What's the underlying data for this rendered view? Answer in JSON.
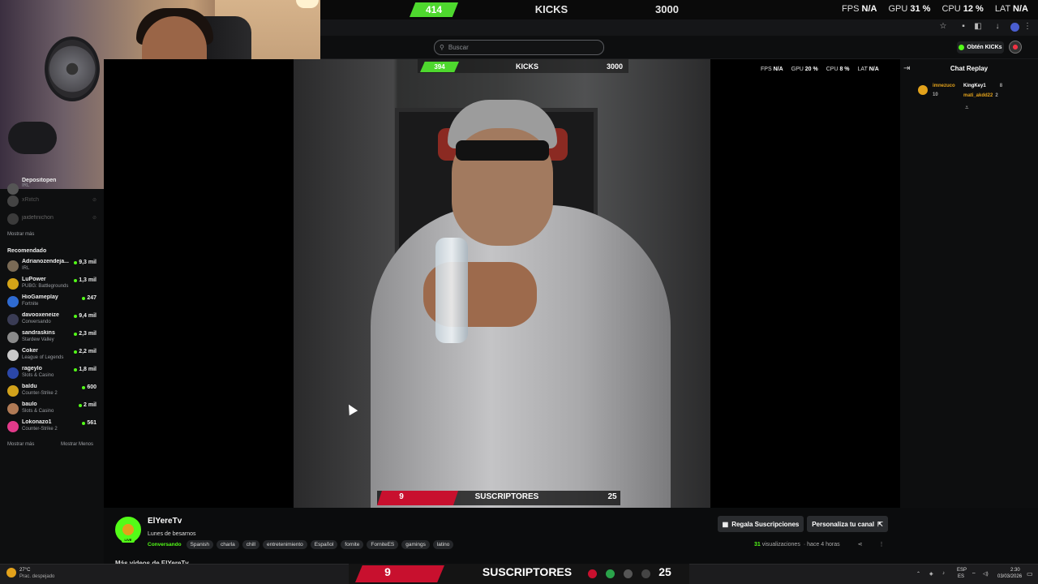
{
  "overlay_top": {
    "counter": "414",
    "kicks_label": "KICKS",
    "kicks_goal": "3000",
    "stats": [
      {
        "label": "FPS",
        "value": "N/A"
      },
      {
        "label": "GPU",
        "value": "31 %"
      },
      {
        "label": "CPU",
        "value": "12 %"
      },
      {
        "label": "LAT",
        "value": "N/A"
      }
    ]
  },
  "header": {
    "search_placeholder": "Buscar",
    "get_kicks_label": "Obtén KICKs"
  },
  "overlay_inner": {
    "counter": "394",
    "kicks_label": "KICKS",
    "kicks_goal": "3000",
    "stats": [
      {
        "label": "FPS",
        "value": "N/A"
      },
      {
        "label": "GPU",
        "value": "20 %"
      },
      {
        "label": "CPU",
        "value": "8 %"
      },
      {
        "label": "LAT",
        "value": "N/A"
      }
    ]
  },
  "sidebar": {
    "following_partial": [
      {
        "name": "Depositopen",
        "cat": "IRL"
      },
      {
        "name": "xRiitch",
        "cat": ""
      },
      {
        "name": "jaidefinichon",
        "cat": ""
      }
    ],
    "show_more": "Mostrar más",
    "recommended_title": "Recomendado",
    "recommended": [
      {
        "name": "Adrianozendeja...",
        "cat": "IRL",
        "viewers": "9,3 mil",
        "color": "#7a6a55"
      },
      {
        "name": "LuPower",
        "cat": "PUBG: Battlegrounds",
        "viewers": "1,3 mil",
        "color": "#d4a418"
      },
      {
        "name": "HioGameplay",
        "cat": "Fortnite",
        "viewers": "247",
        "color": "#2f6bd1"
      },
      {
        "name": "davooxeneize",
        "cat": "Conversando",
        "viewers": "9,4 mil",
        "color": "#3a3c55"
      },
      {
        "name": "sandraskins",
        "cat": "Stardew Valley",
        "viewers": "2,3 mil",
        "color": "#8a8a8a"
      },
      {
        "name": "Coker",
        "cat": "League of Legends",
        "viewers": "2,2 mil",
        "color": "#c9c9c9"
      },
      {
        "name": "rageylo",
        "cat": "Slots & Casino",
        "viewers": "1,8 mil",
        "color": "#2b47a8"
      },
      {
        "name": "baldu",
        "cat": "Counter-Strike 2",
        "viewers": "600",
        "color": "#d2a21b"
      },
      {
        "name": "baulo",
        "cat": "Slots & Casino",
        "viewers": "2 mil",
        "color": "#b07a55"
      },
      {
        "name": "Lokonazo1",
        "cat": "Counter-Strike 2",
        "viewers": "561",
        "color": "#e23a8a"
      }
    ],
    "show_more_2": "Mostrar más",
    "show_less": "Mostrar Menos"
  },
  "chat": {
    "title": "Chat Replay",
    "chips": [
      {
        "name": "imnezuco",
        "count": "10"
      },
      {
        "name": "KingKey1",
        "count": "8"
      },
      {
        "name": "mati_akdd22",
        "count": "2"
      }
    ]
  },
  "subs_overlay": {
    "left": "9",
    "label": "SUSCRIPTORES",
    "right": "25"
  },
  "channel": {
    "name": "ElYereTv",
    "title": "Lunes de besarnos",
    "category": "Conversando",
    "tags": [
      "Spanish",
      "charla",
      "chill",
      "entretenimiento",
      "Español",
      "fornite",
      "ForniteES",
      "gamings",
      "latino"
    ],
    "views_count": "31",
    "views_label": "visualizaciones",
    "time_ago": "· hace 4 horas",
    "gift_button": "Regala Suscripciones",
    "customize_button": "Personaliza tu canal",
    "more_videos": "Más videos de ElYereTv"
  },
  "taskbar": {
    "weather_temp": "27°C",
    "weather_desc": "Prac. despejado",
    "lang": "ESP",
    "lang2": "ES",
    "time": "2:30",
    "date": "03/03/2026"
  },
  "colors": {
    "accent": "#53fc18",
    "counter_green": "#4ed82e",
    "subs_red": "#c8102e"
  }
}
